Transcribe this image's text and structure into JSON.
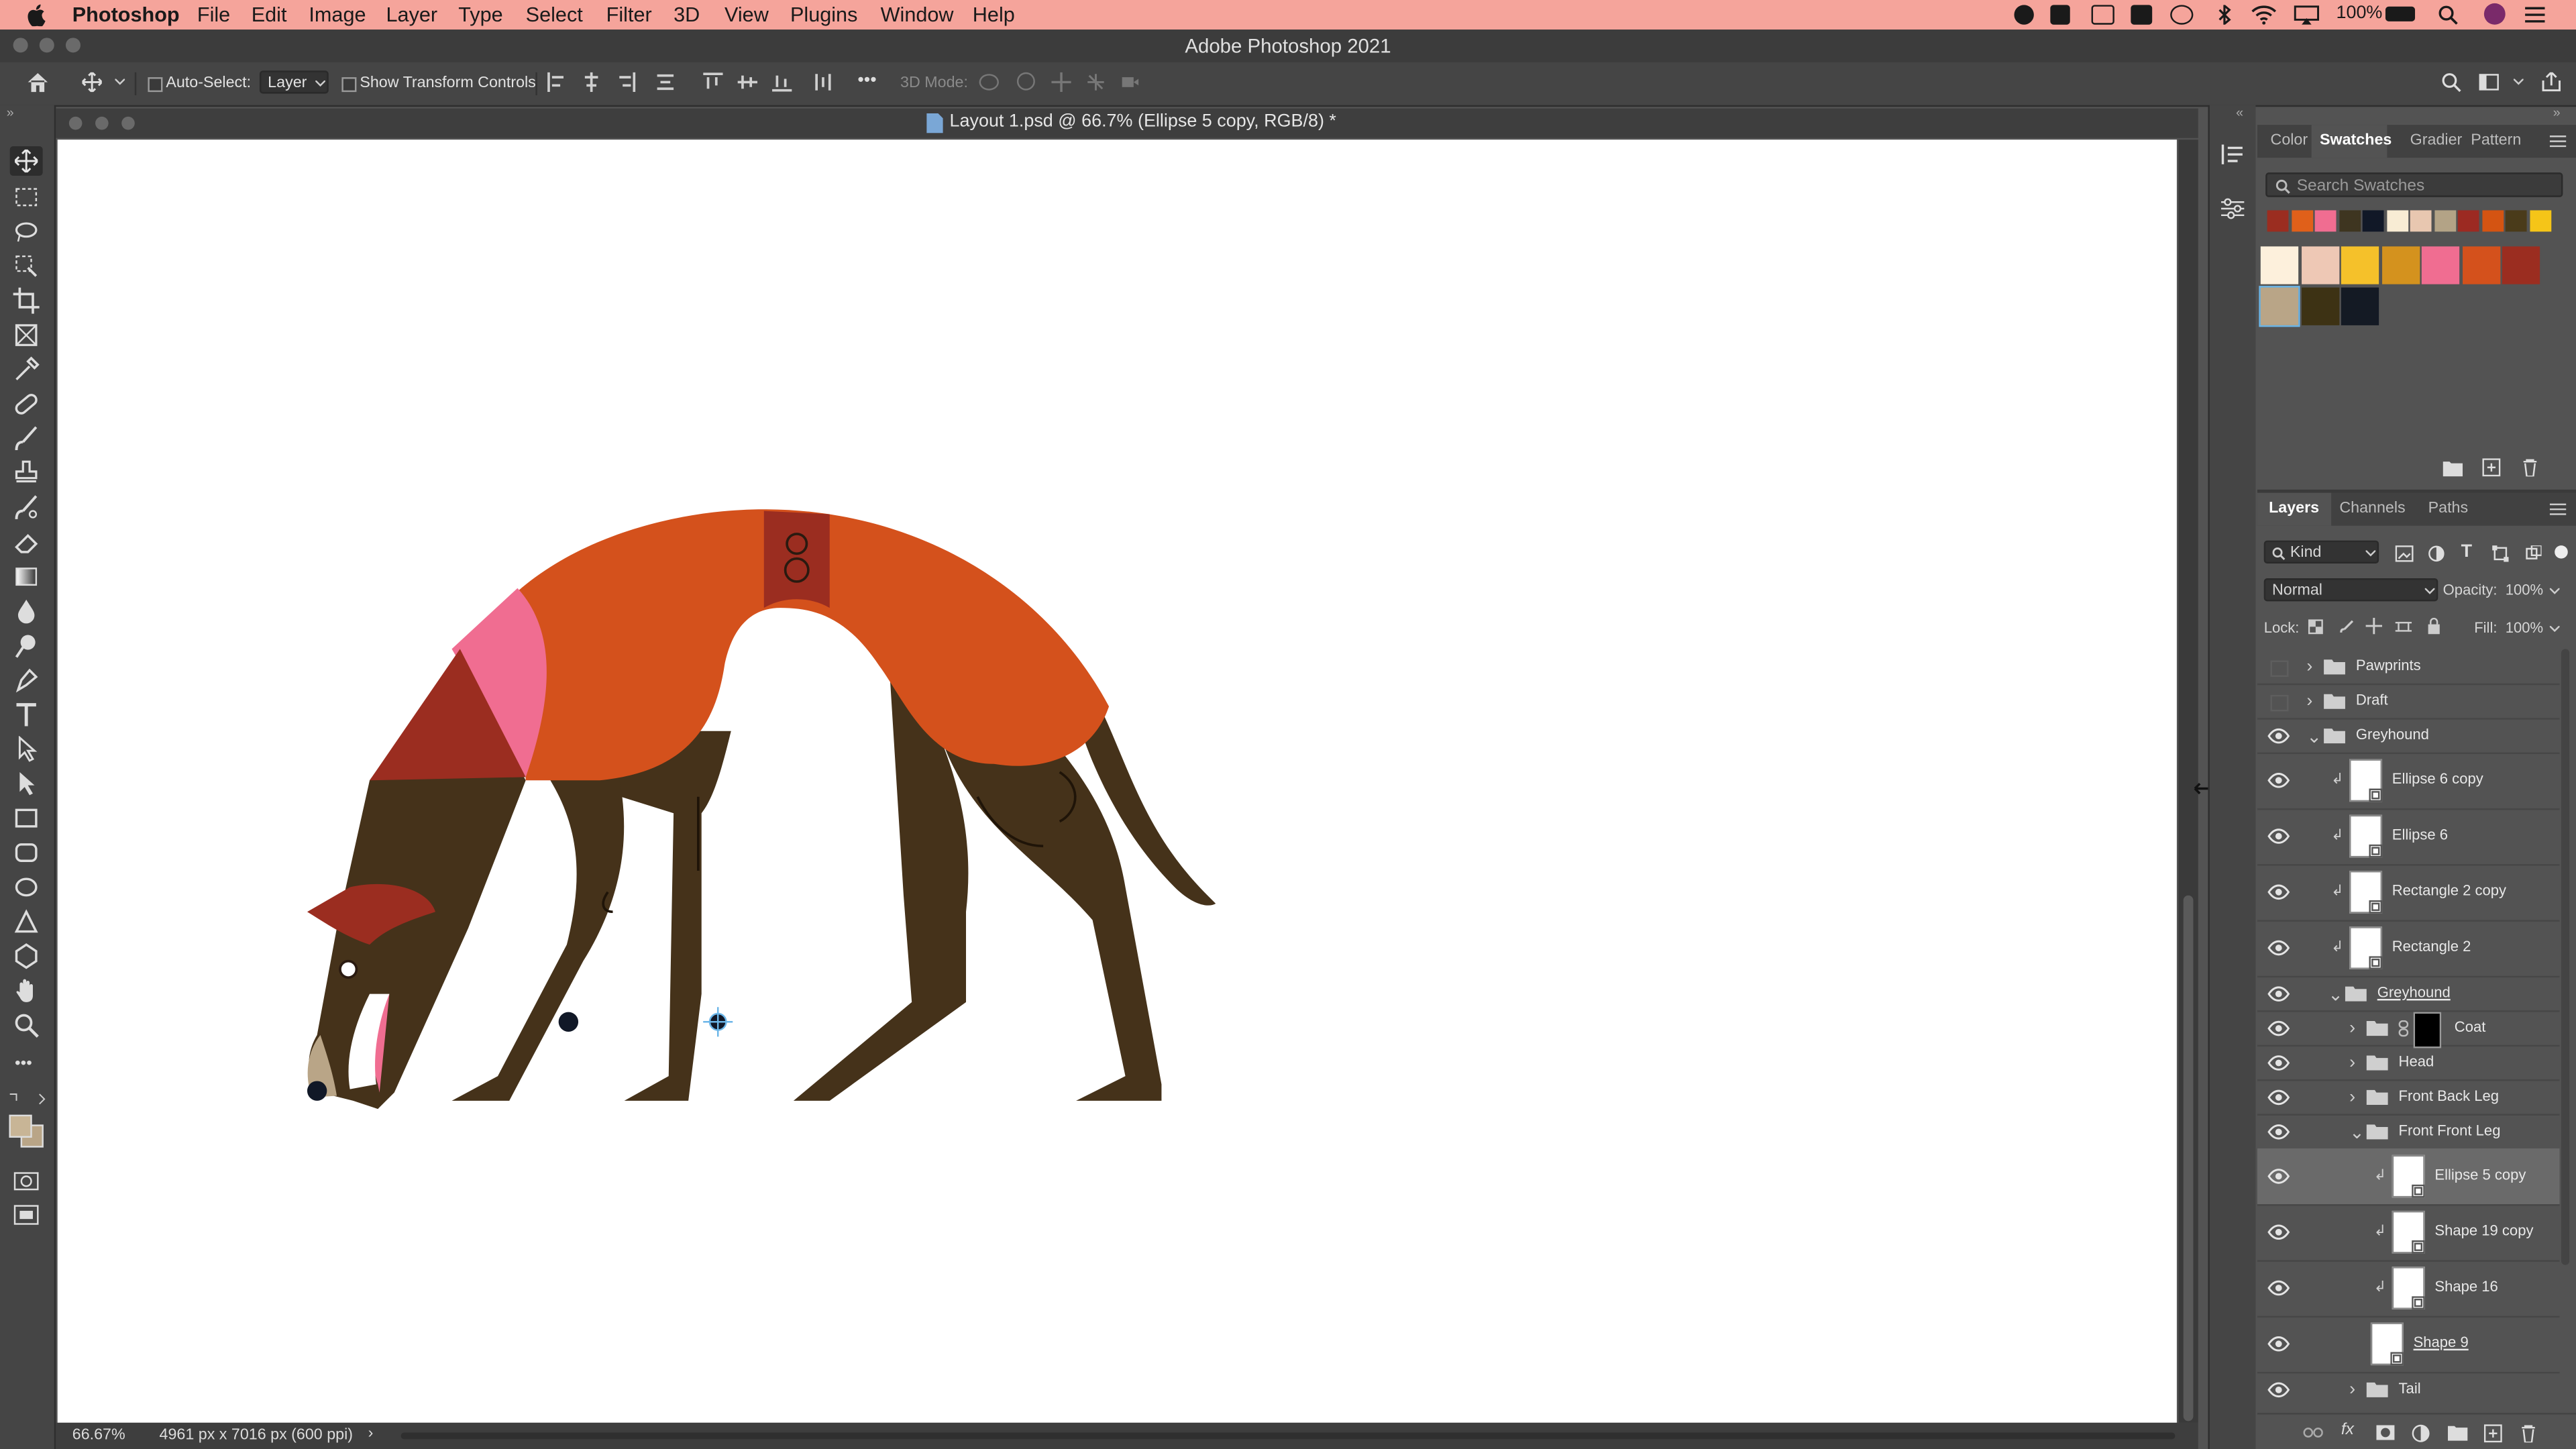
{
  "menubar": {
    "apple": "",
    "app": "Photoshop",
    "items": [
      "File",
      "Edit",
      "Image",
      "Layer",
      "Type",
      "Select",
      "Filter",
      "3D",
      "View",
      "Plugins",
      "Window",
      "Help"
    ],
    "battery": "100%"
  },
  "window": {
    "title": "Adobe Photoshop 2021"
  },
  "options": {
    "auto_select_label": "Auto-Select:",
    "auto_select_value": "Layer",
    "show_transform_label": "Show Transform Controls",
    "mode_3d_label": "3D Mode:",
    "more": "•••"
  },
  "document": {
    "tab_title": "Layout 1.psd @ 66.7% (Ellipse 5 copy, RGB/8) *",
    "zoom": "66.67%",
    "doc_info": "4961 px x 7016 px (600 ppi)",
    "status_arrow": "›"
  },
  "swatches_panel": {
    "tabs": [
      "Color",
      "Swatches",
      "Gradier",
      "Pattern"
    ],
    "active_tab": "Swatches",
    "search_placeholder": "Search Swatches",
    "small_swatches": [
      "#9b2d20",
      "#e0601a",
      "#f06d91",
      "#3e3520",
      "#111827",
      "#f8ecd4",
      "#e8c7b0",
      "#b3a386",
      "#9c2a22",
      "#d45412",
      "#4a3b1a",
      "#f5c518"
    ],
    "large_swatches": [
      "#fdf0dc",
      "#eec8b5",
      "#f5c12a",
      "#d4921e",
      "#f06d91",
      "#d4511c",
      "#9b2d20",
      "#b9a587",
      "#3d3214",
      "#141a24"
    ]
  },
  "layers_panel": {
    "tabs": [
      "Layers",
      "Channels",
      "Paths"
    ],
    "active_tab": "Layers",
    "filter_kind": "Kind",
    "blend_mode": "Normal",
    "opacity_label": "Opacity:",
    "opacity_value": "100%",
    "lock_label": "Lock:",
    "fill_label": "Fill:",
    "fill_value": "100%",
    "layers": [
      {
        "name": "Pawprints",
        "kind": "group",
        "visible": false,
        "depth": 0,
        "expanded": false
      },
      {
        "name": "Draft",
        "kind": "group",
        "visible": false,
        "depth": 0,
        "expanded": false
      },
      {
        "name": "Greyhound",
        "kind": "group",
        "visible": true,
        "depth": 0,
        "expanded": true
      },
      {
        "name": "Ellipse 6 copy",
        "kind": "layer",
        "visible": true,
        "depth": 1
      },
      {
        "name": "Ellipse 6",
        "kind": "layer",
        "visible": true,
        "depth": 1
      },
      {
        "name": "Rectangle 2 copy",
        "kind": "layer",
        "visible": true,
        "depth": 1
      },
      {
        "name": "Rectangle 2",
        "kind": "layer",
        "visible": true,
        "depth": 1
      },
      {
        "name": "Greyhound",
        "kind": "group",
        "visible": true,
        "depth": 1,
        "expanded": true
      },
      {
        "name": "Coat",
        "kind": "group-mask",
        "visible": true,
        "depth": 2,
        "expanded": false
      },
      {
        "name": "Head",
        "kind": "group",
        "visible": true,
        "depth": 2,
        "expanded": false
      },
      {
        "name": "Front Back Leg",
        "kind": "group",
        "visible": true,
        "depth": 2,
        "expanded": false
      },
      {
        "name": "Front Front Leg",
        "kind": "group",
        "visible": true,
        "depth": 2,
        "expanded": true
      },
      {
        "name": "Ellipse 5 copy",
        "kind": "layer",
        "visible": true,
        "depth": 3,
        "selected": true
      },
      {
        "name": "Shape 19 copy",
        "kind": "layer",
        "visible": true,
        "depth": 3
      },
      {
        "name": "Shape 16",
        "kind": "layer",
        "visible": true,
        "depth": 3
      },
      {
        "name": "Shape 9",
        "kind": "layer",
        "visible": true,
        "depth": 2
      },
      {
        "name": "Tail",
        "kind": "group",
        "visible": true,
        "depth": 2,
        "expanded": false
      }
    ]
  },
  "colors": {
    "menubar_bg": "#f5a49b",
    "coat_orange": "#d4511c",
    "body_brown": "#45321a",
    "pink": "#f06d91",
    "red": "#9b2d20"
  }
}
